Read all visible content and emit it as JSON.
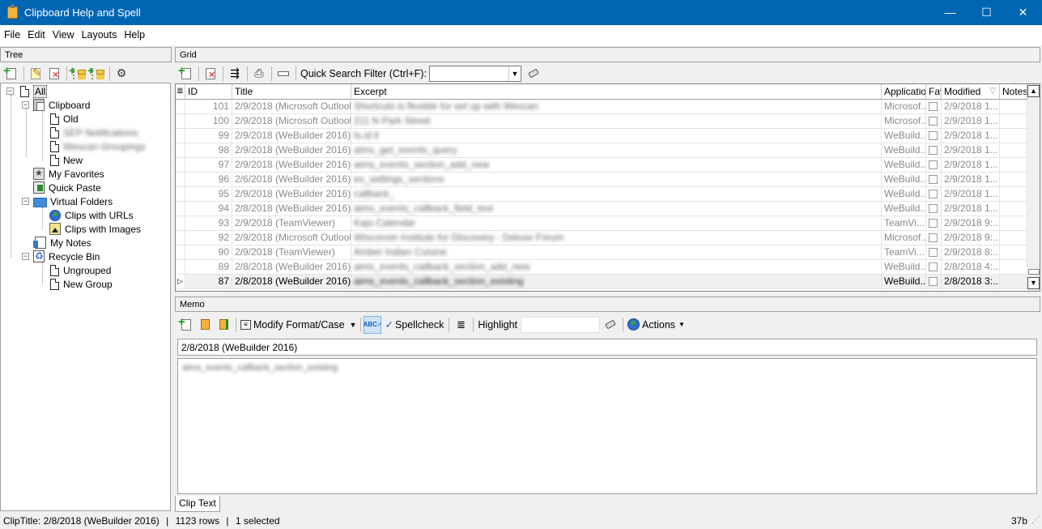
{
  "window": {
    "title": "Clipboard Help and Spell",
    "minimize_glyph": "—",
    "maximize_glyph": "☐",
    "close_glyph": "✕"
  },
  "menu": [
    "File",
    "Edit",
    "View",
    "Layouts",
    "Help"
  ],
  "tree": {
    "header": "Tree",
    "nodes": [
      {
        "label": "All",
        "icon": "document-icon"
      },
      {
        "label": "Clipboard",
        "icon": "clipboard-icon"
      },
      {
        "label": "Old",
        "icon": "document-icon"
      },
      {
        "label": "SEP Notifications",
        "icon": "document-icon"
      },
      {
        "label": "Wescan Groupings",
        "icon": "document-icon"
      },
      {
        "label": "New",
        "icon": "document-icon"
      },
      {
        "label": "My Favorites",
        "icon": "favorites-icon"
      },
      {
        "label": "Quick Paste",
        "icon": "quick-paste-icon"
      },
      {
        "label": "Virtual Folders",
        "icon": "folder-icon"
      },
      {
        "label": "Clips with URLs",
        "icon": "globe-icon"
      },
      {
        "label": "Clips with Images",
        "icon": "image-icon"
      },
      {
        "label": "My Notes",
        "icon": "notes-icon"
      },
      {
        "label": "Recycle Bin",
        "icon": "recycle-bin-icon"
      },
      {
        "label": "Ungrouped",
        "icon": "document-icon"
      },
      {
        "label": "New Group",
        "icon": "document-icon"
      }
    ]
  },
  "grid": {
    "header": "Grid",
    "quick_search_label": "Quick Search Filter (Ctrl+F):",
    "quick_search_value": "",
    "columns": [
      "ID",
      "Title",
      "Excerpt",
      "Application",
      "Fav",
      "Modified",
      "Notes"
    ],
    "rows": [
      {
        "id": "101",
        "title": "2/9/2018 (Microsoft Outlook)",
        "excerpt": "Shortcuts is flexible for set up with Wescan",
        "app": "Microsof...",
        "modified": "2/9/2018 1..."
      },
      {
        "id": "100",
        "title": "2/9/2018 (Microsoft Outlook)",
        "excerpt": "211 N Park Street",
        "app": "Microsof...",
        "modified": "2/9/2018 1..."
      },
      {
        "id": "99",
        "title": "2/9/2018 (WeBuilder 2016)",
        "excerpt": "ts.id ll",
        "app": "WeBuild...",
        "modified": "2/9/2018 1..."
      },
      {
        "id": "98",
        "title": "2/9/2018 (WeBuilder 2016)",
        "excerpt": "aims_get_events_query",
        "app": "WeBuild...",
        "modified": "2/9/2018 1..."
      },
      {
        "id": "97",
        "title": "2/9/2018 (WeBuilder 2016)",
        "excerpt": "aims_events_section_add_new",
        "app": "WeBuild...",
        "modified": "2/9/2018 1..."
      },
      {
        "id": "96",
        "title": "2/6/2018 (WeBuilder 2016)",
        "excerpt": "ev_settings_sections",
        "app": "WeBuild...",
        "modified": "2/9/2018 1..."
      },
      {
        "id": "95",
        "title": "2/9/2018 (WeBuilder 2016)",
        "excerpt": "callback_",
        "app": "WeBuild...",
        "modified": "2/9/2018 1..."
      },
      {
        "id": "94",
        "title": "2/8/2018 (WeBuilder 2016)",
        "excerpt": "aims_events_callback_field_text",
        "app": "WeBuild...",
        "modified": "2/9/2018 1..."
      },
      {
        "id": "93",
        "title": "2/9/2018 (TeamViewer)",
        "excerpt": "Kajo Calendar",
        "app": "TeamVi...",
        "modified": "2/9/2018 9:..."
      },
      {
        "id": "92",
        "title": "2/9/2018 (Microsoft Outlook)",
        "excerpt": "Wisconsin Institute for Discovery - Deluxe Forum",
        "app": "Microsof...",
        "modified": "2/9/2018 9:..."
      },
      {
        "id": "90",
        "title": "2/9/2018 (TeamViewer)",
        "excerpt": "Amber Indian Cuisine",
        "app": "TeamVi...",
        "modified": "2/9/2018 8:..."
      },
      {
        "id": "89",
        "title": "2/8/2018 (WeBuilder 2016)",
        "excerpt": "aims_events_callback_section_add_new",
        "app": "WeBuild...",
        "modified": "2/8/2018 4:..."
      },
      {
        "id": "87",
        "title": "2/8/2018 (WeBuilder 2016)",
        "excerpt": "aims_events_callback_section_existing",
        "app": "WeBuild...",
        "modified": "2/8/2018 3:...",
        "selected": true
      }
    ]
  },
  "memo": {
    "header": "Memo",
    "modify_format_label": "Modify Format/Case",
    "spellcheck_label": "Spellcheck",
    "highlight_label": "Highlight",
    "highlight_value": "",
    "actions_label": "Actions",
    "title_value": "2/8/2018 (WeBuilder 2016)",
    "body_text": "aims_events_callback_section_existing",
    "tab_label": "Clip Text"
  },
  "status": {
    "clip_title": "ClipTitle:  2/8/2018 (WeBuilder 2016)",
    "rows": "1123 rows",
    "selected": "1 selected",
    "size": "37b"
  },
  "colors": {
    "titlebar": "#0066b4",
    "accent_green": "#1a9a1a",
    "accent_red": "#d02020"
  }
}
